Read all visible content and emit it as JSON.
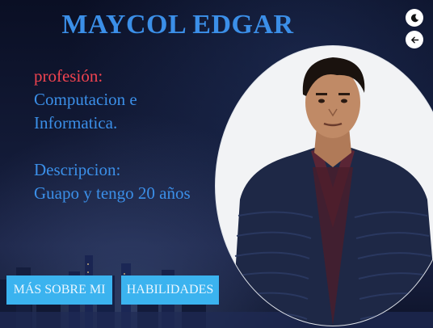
{
  "header": {
    "title": "MAYCOL EDGAR"
  },
  "controls": {
    "theme_icon": "moon-icon",
    "back_icon": "arrow-left-icon"
  },
  "profile": {
    "profession_label": "profesión:",
    "profession_line1": "Computacion e",
    "profession_line2": "Informatica.",
    "description_label": "Descripcion:",
    "description_text": "Guapo y tengo 20 años"
  },
  "buttons": {
    "about": "MÁS SOBRE MI",
    "skills": "HABILIDADES"
  },
  "colors": {
    "title": "#3b8fe8",
    "label": "#f04350",
    "button": "#3bb3ef"
  }
}
